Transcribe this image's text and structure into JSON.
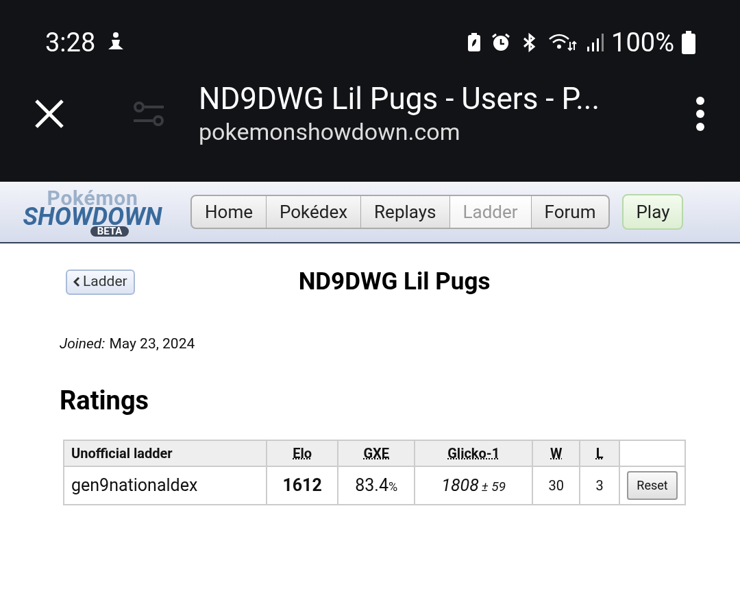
{
  "status_bar": {
    "time": "3:28",
    "battery": "100%"
  },
  "browser": {
    "title": "ND9DWG Lil Pugs - Users - P...",
    "url": "pokemonshowdown.com"
  },
  "logo": {
    "top": "Pokémon",
    "main": "SHOWDOWN",
    "badge": "BETA"
  },
  "nav": [
    {
      "label": "Home",
      "selected": false
    },
    {
      "label": "Pokédex",
      "selected": false
    },
    {
      "label": "Replays",
      "selected": false
    },
    {
      "label": "Ladder",
      "selected": true
    },
    {
      "label": "Forum",
      "selected": false
    }
  ],
  "play_button": "Play",
  "back_button": "Ladder",
  "user_name": "ND9DWG Lil Pugs",
  "joined": {
    "label": "Joined:",
    "value": "May 23, 2024"
  },
  "ratings_heading": "Ratings",
  "table": {
    "columns": [
      "Unofficial ladder",
      "Elo",
      "GXE",
      "Glicko-1",
      "W",
      "L"
    ],
    "rows": [
      {
        "ladder": "gen9nationaldex",
        "elo": "1612",
        "gxe": "83.4",
        "gxe_unit": "%",
        "glicko": "1808",
        "glicko_dev": "± 59",
        "w": "30",
        "l": "3",
        "action": "Reset"
      }
    ]
  }
}
